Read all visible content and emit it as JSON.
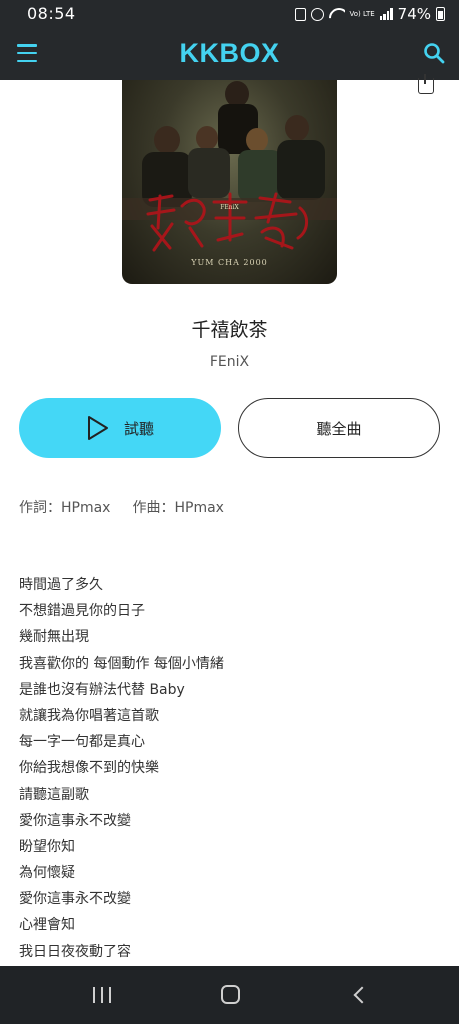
{
  "status_bar": {
    "time": "08:54",
    "network_label": "Vo) LTE",
    "battery": "74%"
  },
  "header": {
    "logo": "KKBOX",
    "accent_color": "#44d2f0"
  },
  "album": {
    "brand": "FEniX",
    "subtitle": "YUM CHA 2000"
  },
  "song": {
    "title": "千禧飲茶",
    "artist": "FEniX"
  },
  "actions": {
    "preview_label": "試聽",
    "full_song_label": "聽全曲",
    "preview_color": "#44d7f6"
  },
  "credits": {
    "lyricist": "作詞：HPmax",
    "composer": "作曲：HPmax"
  },
  "lyrics": [
    "時間過了多久",
    "不想錯過見你的日子",
    "幾耐無出現",
    "我喜歡你的 每個動作 每個小情緒",
    "是誰也沒有辦法代替 Baby",
    "就讓我為你唱著這首歌",
    "每一字一句都是真心",
    "你給我想像不到的快樂",
    "請聽這副歌",
    "愛你這事永不改變",
    "盼望你知",
    "為何懷疑",
    "愛你這事永不改變",
    "心裡會知",
    "我日日夜夜動了容"
  ]
}
